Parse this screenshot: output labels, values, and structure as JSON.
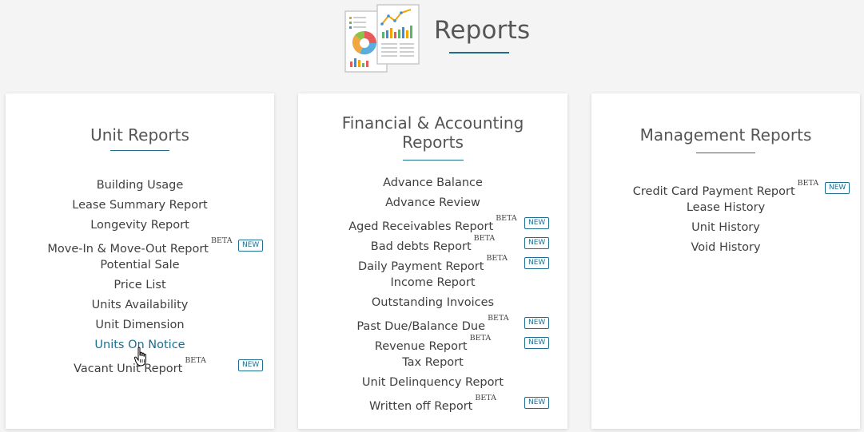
{
  "page": {
    "title": "Reports"
  },
  "cards": [
    {
      "title_lines": [
        "Unit Reports"
      ],
      "items": [
        {
          "label": "Building Usage",
          "beta": "",
          "new": ""
        },
        {
          "label": "Lease Summary Report",
          "beta": "",
          "new": ""
        },
        {
          "label": "Longevity Report",
          "beta": "",
          "new": ""
        },
        {
          "label": "Move-In & Move-Out Report",
          "beta": "BETA",
          "new": "NEW"
        },
        {
          "label": "Potential Sale",
          "beta": "",
          "new": ""
        },
        {
          "label": "Price List",
          "beta": "",
          "new": ""
        },
        {
          "label": "Units Availability",
          "beta": "",
          "new": ""
        },
        {
          "label": "Unit Dimension",
          "beta": "",
          "new": ""
        },
        {
          "label": "Units On Notice",
          "beta": "",
          "new": "",
          "active": true
        },
        {
          "label": "Vacant Unit Report",
          "beta": "BETA",
          "new": "NEW"
        }
      ]
    },
    {
      "title_lines": [
        "Financial & Accounting",
        "Reports"
      ],
      "items": [
        {
          "label": "Advance Balance",
          "beta": "",
          "new": ""
        },
        {
          "label": "Advance Review",
          "beta": "",
          "new": ""
        },
        {
          "label": "Aged Receivables Report",
          "beta": "BETA",
          "new": "NEW"
        },
        {
          "label": "Bad debts Report",
          "beta": "BETA",
          "new": "NEW"
        },
        {
          "label": "Daily Payment Report",
          "beta": "BETA",
          "new": "NEW"
        },
        {
          "label": "Income Report",
          "beta": "",
          "new": ""
        },
        {
          "label": "Outstanding Invoices",
          "beta": "",
          "new": ""
        },
        {
          "label": "Past Due/Balance Due",
          "beta": "BETA",
          "new": "NEW"
        },
        {
          "label": "Revenue Report",
          "beta": "BETA",
          "new": "NEW"
        },
        {
          "label": "Tax Report",
          "beta": "",
          "new": ""
        },
        {
          "label": "Unit Delinquency Report",
          "beta": "",
          "new": ""
        },
        {
          "label": "Written off Report",
          "beta": "BETA",
          "new": "NEW"
        }
      ]
    },
    {
      "title_lines": [
        "Management Reports"
      ],
      "items": [
        {
          "label": "Credit Card Payment Report",
          "beta": "BETA",
          "new": "NEW"
        },
        {
          "label": "Lease History",
          "beta": "",
          "new": ""
        },
        {
          "label": "Unit History",
          "beta": "",
          "new": ""
        },
        {
          "label": "Void History",
          "beta": "",
          "new": ""
        }
      ]
    }
  ],
  "colors": {
    "accent": "#1d6e8e",
    "background": "#f4f4f4",
    "card": "#ffffff",
    "text": "#3f3f3f"
  },
  "icons": {
    "header": "reports-charts-icon",
    "cursor": "hand-pointer-cursor"
  }
}
